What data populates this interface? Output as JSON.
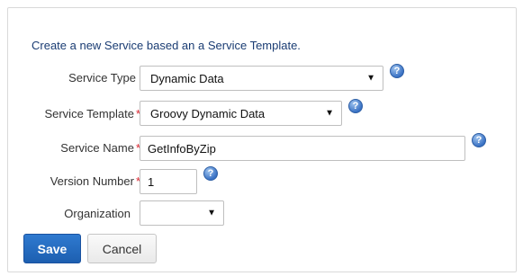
{
  "form": {
    "intro": "Create a new Service based an a Service Template.",
    "service_type": {
      "label": "Service Type",
      "value": "Dynamic Data"
    },
    "service_template": {
      "label": "Service Template",
      "required_mark": "*",
      "value": "Groovy Dynamic Data"
    },
    "service_name": {
      "label": "Service Name",
      "required_mark": "*",
      "value": "GetInfoByZip"
    },
    "version_number": {
      "label": "Version Number",
      "required_mark": "*",
      "value": "1"
    },
    "organization": {
      "label": "Organization",
      "value": ""
    },
    "help_glyph": "?",
    "caret_glyph": "▼"
  },
  "actions": {
    "save_label": "Save",
    "cancel_label": "Cancel"
  },
  "colors": {
    "primary": "#1d5fb0",
    "required": "#d9232d",
    "help": "#3a72c4",
    "intro_text": "#1a3c73"
  },
  "icons": {
    "help": "help-icon",
    "dropdown": "chevron-down-icon"
  }
}
